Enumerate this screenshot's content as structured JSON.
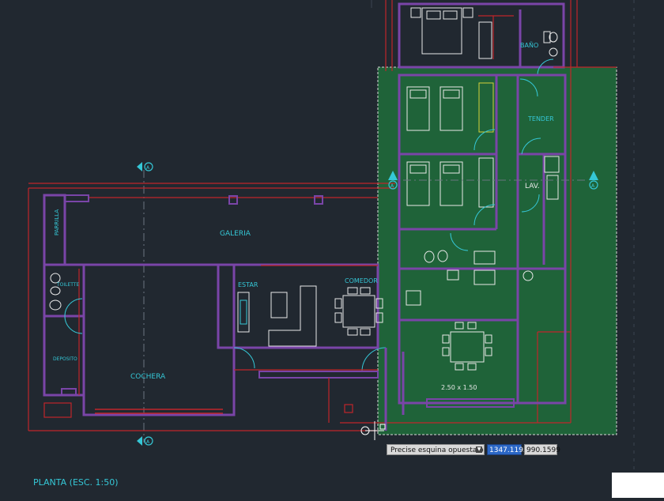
{
  "colors": {
    "background": "#212830",
    "wall": "#7a45a8",
    "red": "#c0262b",
    "white": "#e8e8e8",
    "cyan": "#35c7d6",
    "selection_fill": "#1f6b3a",
    "selection_border": "#d8d8d8"
  },
  "labels": {
    "bano": "BAÑO",
    "tender": "TENDER",
    "lav": "LAV.",
    "galeria": "GALERIA",
    "parrilla": "PARRILLA",
    "toilette": "TOILETTE",
    "estar": "ESTAR",
    "comedor": "COMEDOR",
    "deposito": "DEPOSITO",
    "cochera": "COCHERA",
    "dimension": "2.50 x 1.50",
    "plan_title": "PLANTA (ESC. 1:50)",
    "section_marker_letter": "A"
  },
  "command": {
    "prompt": "Precise esquina opuesta o",
    "x_value": "1347.1195",
    "y_value": "990.1599"
  },
  "icons": {
    "dropdown": "chevron-down-icon",
    "section_marker": "section-arrow-icon"
  }
}
